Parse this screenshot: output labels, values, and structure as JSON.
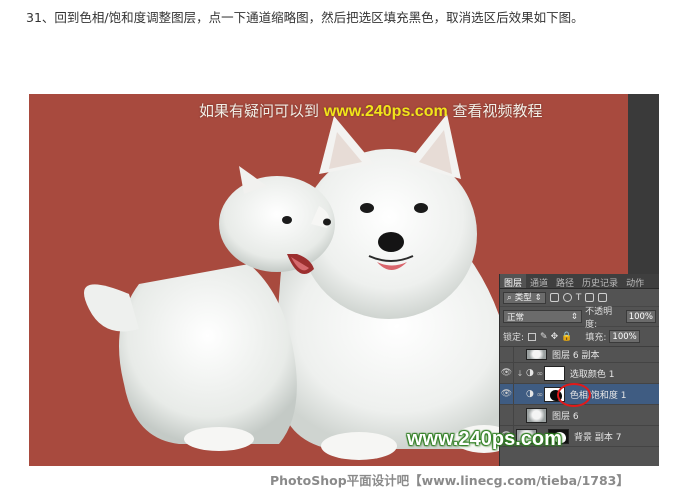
{
  "instruction": "31、回到色相/饱和度调整图层，点一下通道缩略图，然后把选区填充黑色，取消选区后效果如下图。",
  "photo": {
    "background_color": "#a84a3e",
    "watermark_top_prefix": "如果有疑问可以到",
    "watermark_top_url": "www.240ps.com",
    "watermark_top_suffix": "查看视频教程",
    "watermark_bottom": "www.240ps.com"
  },
  "layers_panel": {
    "tabs": [
      "图层",
      "通道",
      "路径",
      "历史记录",
      "动作"
    ],
    "active_tab": "图层",
    "filter_label": "类型",
    "blend_mode": "正常",
    "opacity_label": "不透明度:",
    "opacity_value": "100%",
    "lock_label": "锁定:",
    "fill_label": "填充:",
    "fill_value": "100%",
    "layers": [
      {
        "name": "图层 6 副本"
      },
      {
        "name": "选取颜色 1"
      },
      {
        "name": "色相/饱和度 1"
      },
      {
        "name": "图层 6"
      },
      {
        "name": "背景 副本 7"
      }
    ],
    "selected_layer": "色相/饱和度 1"
  },
  "footer": "PhotoShop平面设计吧【www.linecg.com/tieba/1783】",
  "colors": {
    "highlight_circle": "#e21a1a",
    "selected_row": "#3f5c82",
    "panel_bg": "#535353"
  }
}
